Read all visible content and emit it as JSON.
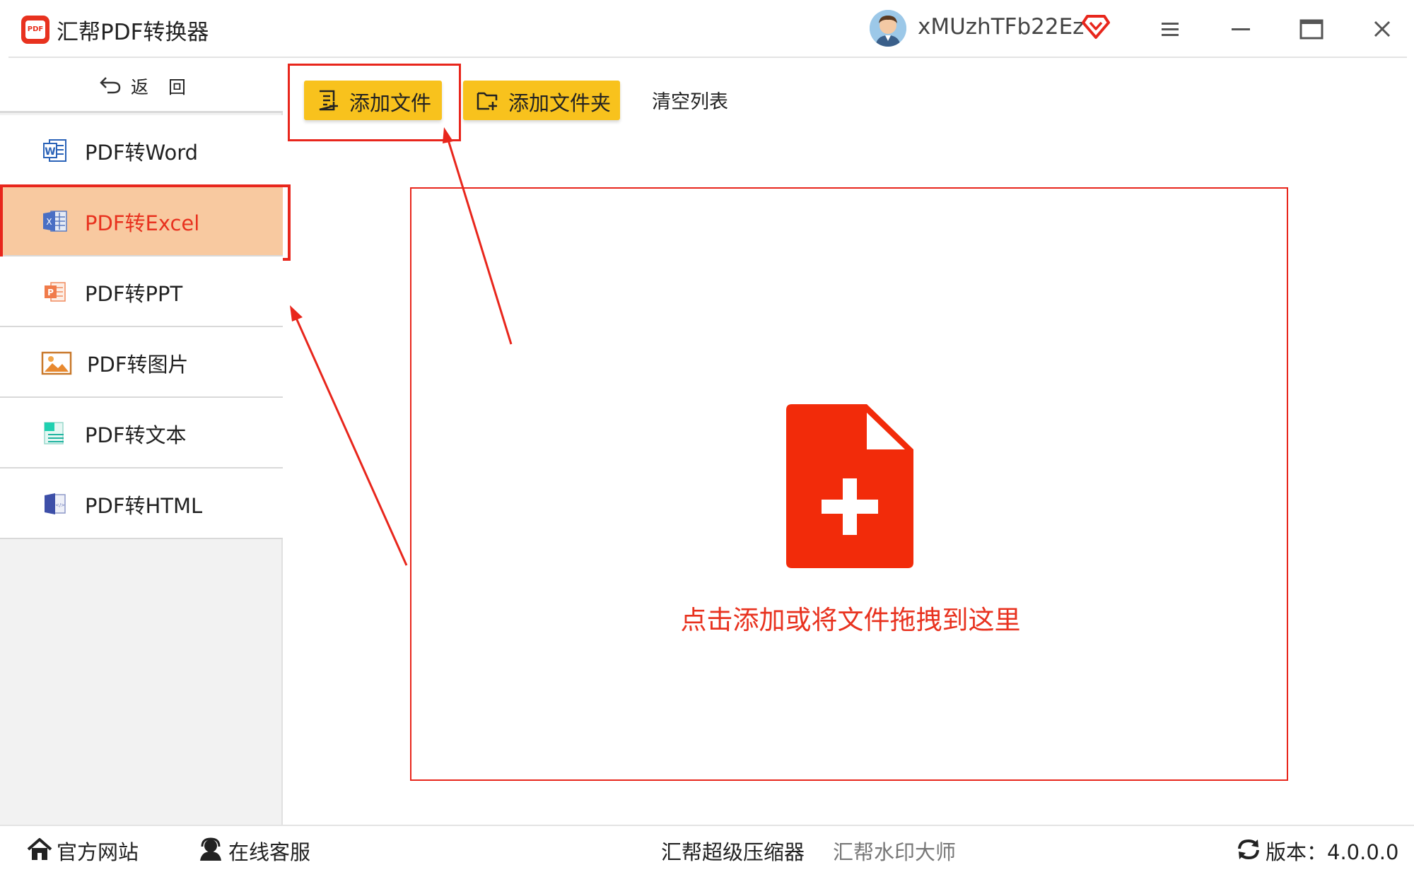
{
  "app": {
    "title": "汇帮PDF转换器",
    "logo_text": "PDF",
    "username": "xMUzhTFb22Ez",
    "accent_color": "#f8c21d",
    "brand_color": "#e8321f"
  },
  "sidebar": {
    "back_label": "返回",
    "items": [
      {
        "label": "PDF转Word",
        "icon": "word-icon",
        "active": false
      },
      {
        "label": "PDF转Excel",
        "icon": "excel-icon",
        "active": true
      },
      {
        "label": "PDF转PPT",
        "icon": "ppt-icon",
        "active": false
      },
      {
        "label": "PDF转图片",
        "icon": "image-icon",
        "active": false
      },
      {
        "label": "PDF转文本",
        "icon": "text-icon",
        "active": false
      },
      {
        "label": "PDF转HTML",
        "icon": "html-icon",
        "active": false
      }
    ]
  },
  "toolbar": {
    "add_file_label": "添加文件",
    "add_folder_label": "添加文件夹",
    "clear_list_label": "清空列表"
  },
  "dropzone": {
    "hint": "点击添加或将文件拖拽到这里"
  },
  "footer": {
    "website_label": "官方网站",
    "support_label": "在线客服",
    "compressor_label": "汇帮超级压缩器",
    "watermark_label": "汇帮水印大师",
    "version_label": "版本：4.0.0.0"
  }
}
